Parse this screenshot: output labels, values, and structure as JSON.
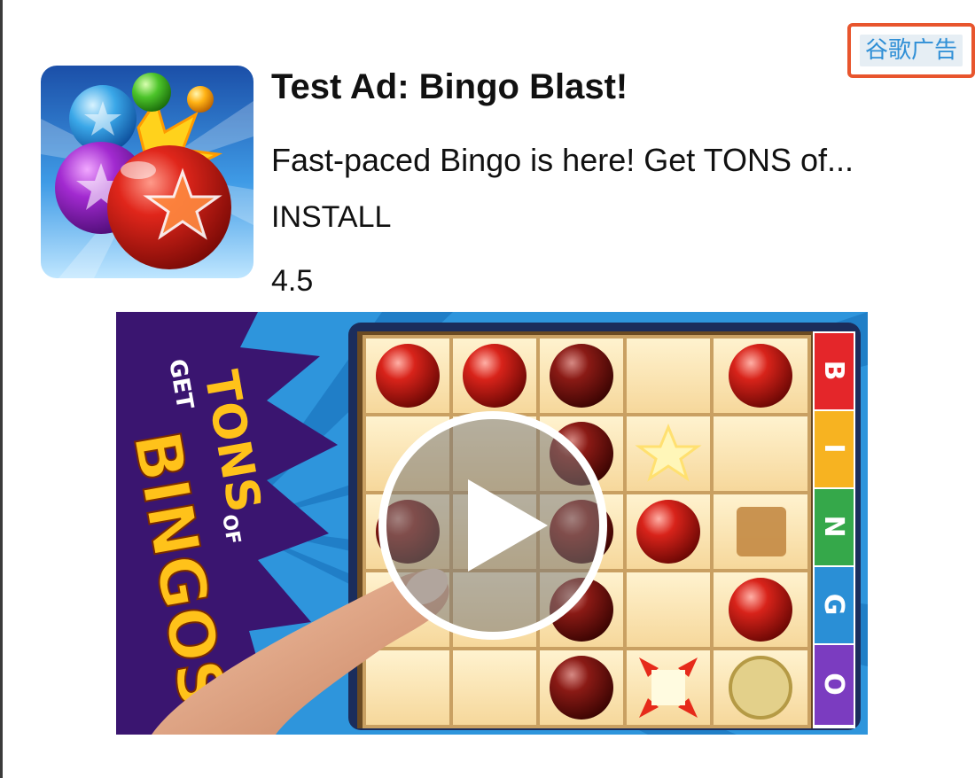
{
  "ad": {
    "badge_label": "谷歌广告",
    "headline": "Test Ad: Bingo Blast!",
    "body": "Fast-paced Bingo is here! Get TONS of...",
    "call_to_action": "INSTALL",
    "star_rating": "4.5"
  },
  "media": {
    "banner_text_top": "GET",
    "banner_text_mid": "TONS",
    "banner_text_of": "OF",
    "banner_text_big": "BINGOS!",
    "bingo_column_letters": [
      "B",
      "I",
      "N",
      "G",
      "O"
    ]
  },
  "colors": {
    "badge_border": "#e8552d",
    "badge_text": "#2f8fd6",
    "badge_bg": "#e6eef4",
    "text": "#111111"
  },
  "icons": {
    "play": "play-icon",
    "app": "bingo-blast-app-icon"
  }
}
